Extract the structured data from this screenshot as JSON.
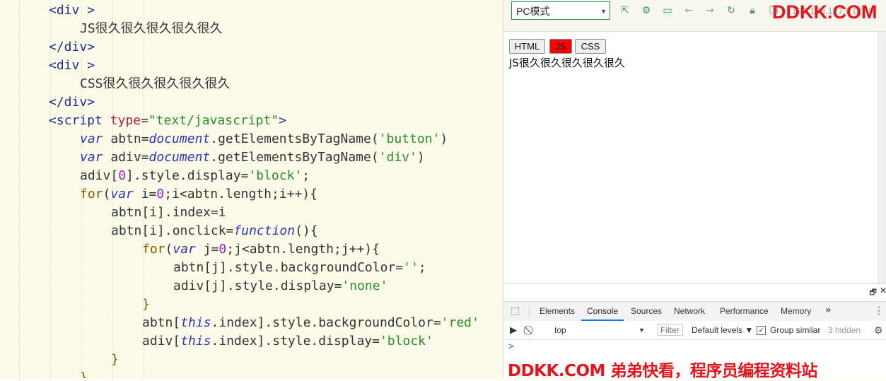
{
  "editor": {
    "lines": [
      [
        [
          "tag",
          "<div "
        ],
        [
          "tag",
          ">"
        ]
      ],
      [
        [
          "txt",
          "JS很久很久很久很久很久"
        ]
      ],
      [
        [
          "tag",
          "</div>"
        ]
      ],
      [
        [
          "tag",
          "<div "
        ],
        [
          "tag",
          ">"
        ]
      ],
      [
        [
          "txt",
          "CSS很久很久很久很久很久"
        ]
      ],
      [
        [
          "tag",
          "</div>"
        ]
      ],
      [
        [
          "tag",
          "<script "
        ],
        [
          "attr",
          "type"
        ],
        [
          "txt",
          "="
        ],
        [
          "str",
          "\"text/javascript\""
        ],
        [
          "tag",
          ">"
        ]
      ],
      [
        [
          "kw",
          "var"
        ],
        [
          "txt",
          " abtn="
        ],
        [
          "kw",
          "document"
        ],
        [
          "txt",
          ".getElementsByTagName("
        ],
        [
          "sstr",
          "'button'"
        ],
        [
          "txt",
          ")"
        ]
      ],
      [
        [
          "kw",
          "var"
        ],
        [
          "txt",
          " adiv="
        ],
        [
          "kw",
          "document"
        ],
        [
          "txt",
          ".getElementsByTagName("
        ],
        [
          "sstr",
          "'div'"
        ],
        [
          "txt",
          ")"
        ]
      ],
      [
        [
          "txt",
          "adiv["
        ],
        [
          "num",
          "0"
        ],
        [
          "txt",
          "].style.display="
        ],
        [
          "sstr",
          "'block'"
        ],
        [
          "txt",
          ";"
        ]
      ],
      [
        [
          "kw2",
          "for"
        ],
        [
          "txt",
          "("
        ],
        [
          "kw",
          "var"
        ],
        [
          "txt",
          " i="
        ],
        [
          "num",
          "0"
        ],
        [
          "txt",
          ";i<abtn.length;i++){"
        ]
      ],
      [
        [
          "txt",
          "abtn[i].index=i"
        ]
      ],
      [
        [
          "txt",
          "abtn[i].onclick="
        ],
        [
          "kw",
          "function"
        ],
        [
          "txt",
          "(){"
        ]
      ],
      [
        [
          "kw2",
          "for"
        ],
        [
          "txt",
          "("
        ],
        [
          "kw",
          "var"
        ],
        [
          "txt",
          " j="
        ],
        [
          "num",
          "0"
        ],
        [
          "txt",
          ";j<abtn.length;j++){"
        ]
      ],
      [
        [
          "txt",
          "abtn[j].style.backgroundColor="
        ],
        [
          "sstr",
          "''"
        ],
        [
          "txt",
          ";"
        ]
      ],
      [
        [
          "txt",
          "adiv[j].style.display="
        ],
        [
          "sstr",
          "'none'"
        ]
      ],
      [
        [
          "kw2",
          "}"
        ]
      ],
      [
        [
          "txt",
          "abtn["
        ],
        [
          "kw",
          "this"
        ],
        [
          "txt",
          ".index].style.backgroundColor="
        ],
        [
          "sstr",
          "'red'"
        ]
      ],
      [
        [
          "txt",
          "adiv["
        ],
        [
          "kw",
          "this"
        ],
        [
          "txt",
          ".index].style.display="
        ],
        [
          "sstr",
          "'block'"
        ]
      ],
      [
        [
          "kw2",
          "}"
        ]
      ],
      [
        [
          "kw2",
          "}"
        ]
      ]
    ]
  },
  "browser": {
    "mode_select": "PC模式",
    "url": "192.168.127.0.0.1:8",
    "watermark": "DDKK.COM"
  },
  "preview": {
    "buttons": [
      "HTML",
      "JS",
      "CSS"
    ],
    "active_button": "JS",
    "shown_text": "JS很久很久很久很久很久"
  },
  "devtools": {
    "tabs": [
      "Elements",
      "Console",
      "Sources",
      "Network",
      "Performance",
      "Memory"
    ],
    "active_tab": "Console",
    "more": "»",
    "context": "top",
    "filter_placeholder": "Filter",
    "levels": "Default levels ▼",
    "group_similar": "Group similar",
    "hidden_count": "3 hidden",
    "prompt": ">",
    "watermark": "DDKK.COM 弟弟快看，程序员编程资料站"
  }
}
